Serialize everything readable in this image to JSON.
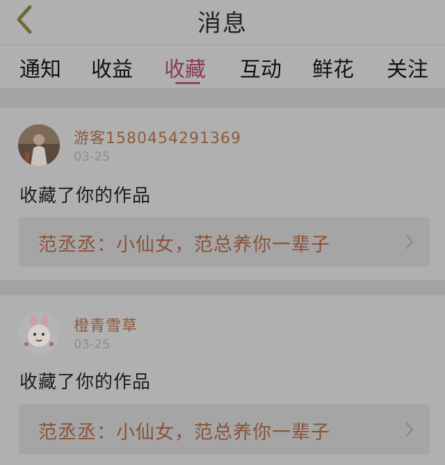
{
  "header": {
    "title": "消息",
    "back_icon": "chevron-left-icon"
  },
  "tabs": [
    {
      "label": "通知",
      "active": false
    },
    {
      "label": "收益",
      "active": false
    },
    {
      "label": "收藏",
      "active": true
    },
    {
      "label": "互动",
      "active": false
    },
    {
      "label": "鲜花",
      "active": false
    },
    {
      "label": "关注",
      "active": false
    }
  ],
  "messages": [
    {
      "user": "游客15804542913​69",
      "date": "03-25",
      "action": "收藏了你的作品",
      "work": "范丞丞：小仙女，范总养你一辈子"
    },
    {
      "user": "橙青雪草",
      "date": "03-25",
      "action": "收藏了你的作品",
      "work": "范丞丞：小仙女，范总养你一辈子"
    }
  ],
  "colors": {
    "accent": "#9c3e5c",
    "username": "#8e5a3e",
    "background": "#a6a6a6"
  }
}
